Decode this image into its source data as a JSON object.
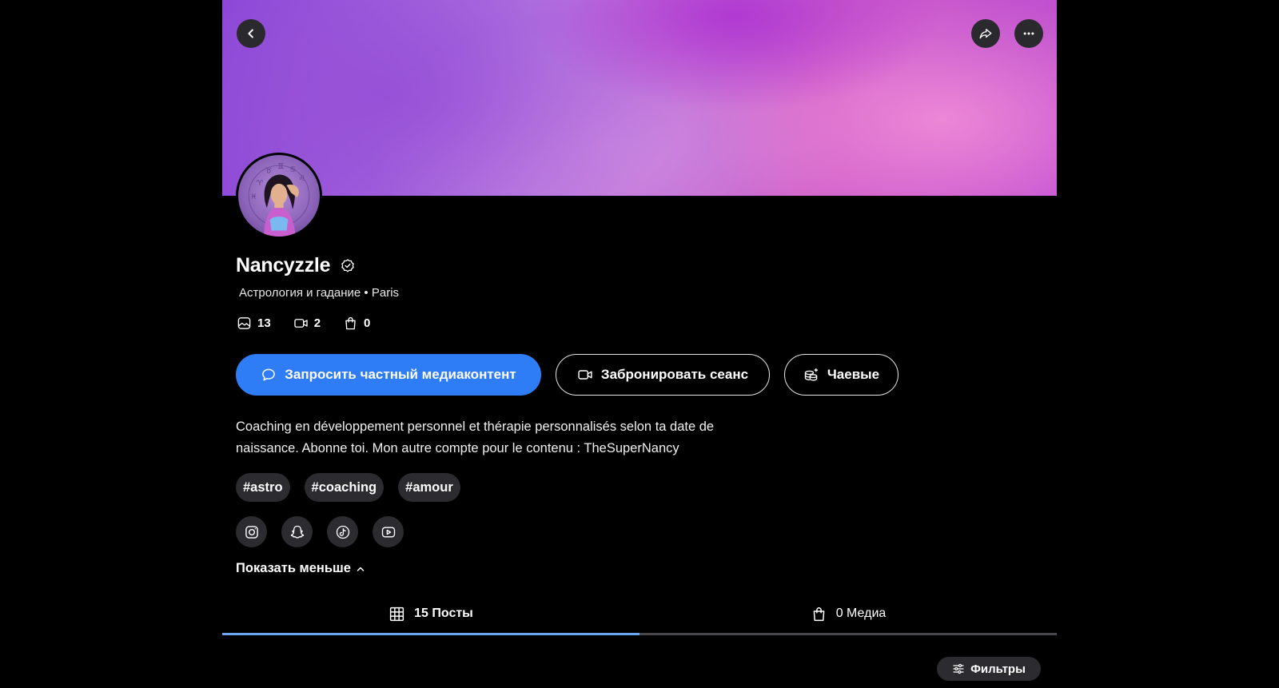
{
  "profile": {
    "name": "Nancyzzle",
    "subtitle": "Астрология и гадание • Paris",
    "verified": true,
    "stats": [
      {
        "icon": "photo-icon",
        "value": "13"
      },
      {
        "icon": "video-icon",
        "value": "2"
      },
      {
        "icon": "shopping-bag-icon",
        "value": "0"
      }
    ],
    "bio": "Coaching en développement personnel et thérapie personnalisés selon ta date de naissance. Abonne toi. Mon autre compte pour le contenu : TheSuperNancy",
    "tags": [
      "#astro",
      "#coaching",
      "#amour"
    ],
    "socials": [
      "instagram-icon",
      "snapchat-icon",
      "tiktok-icon",
      "youtube-icon"
    ],
    "show_less": "Показать меньше"
  },
  "actions": {
    "request_media": "Запросить частный медиаконтент",
    "book_session": "Забронировать сеанс",
    "tips": "Чаевые"
  },
  "tabs": [
    {
      "label": "15 Посты",
      "icon": "grid-icon",
      "active": true
    },
    {
      "label": "0 Медиа",
      "icon": "shopping-bag-icon",
      "active": false
    }
  ],
  "filters_label": "Фильтры",
  "colors": {
    "background": "#000000",
    "primary_button": "#2f7df6",
    "chip_background": "#2c2c30",
    "active_tab_underline": "#6aa3ef"
  }
}
